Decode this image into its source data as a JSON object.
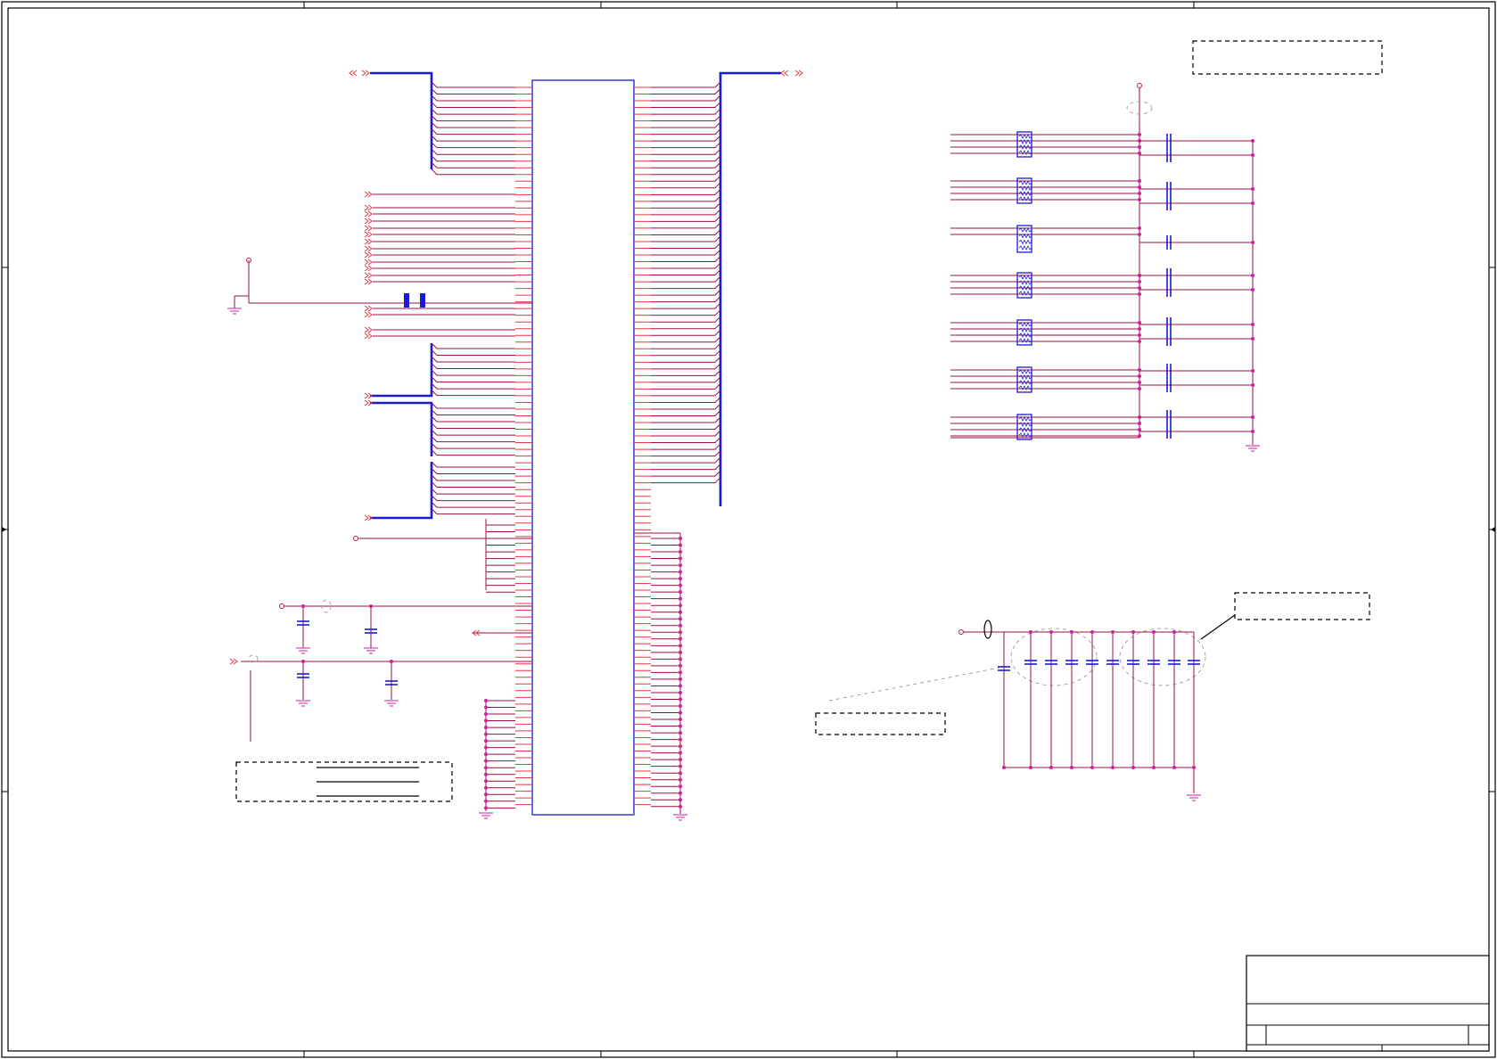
{
  "sheet": {
    "title": "",
    "colors": {
      "wire": "#9a1040",
      "pin": "#e8393f",
      "bus": "#1a1ad8",
      "junction": "#d01fa0",
      "frame": "#000000",
      "annotation": "#9a9a9a"
    }
  },
  "notes": {
    "note_top_right": "",
    "note_mid_right": "",
    "note_bottom_mid": "",
    "note_bottom_left": ""
  },
  "title_block": {
    "title": "",
    "size": "",
    "document_number": "",
    "revision": ""
  },
  "icons": [
    "ground-symbol-icon",
    "offpage-connector-icon",
    "capacitor-icon",
    "resistor-network-icon",
    "power-pin-icon"
  ]
}
